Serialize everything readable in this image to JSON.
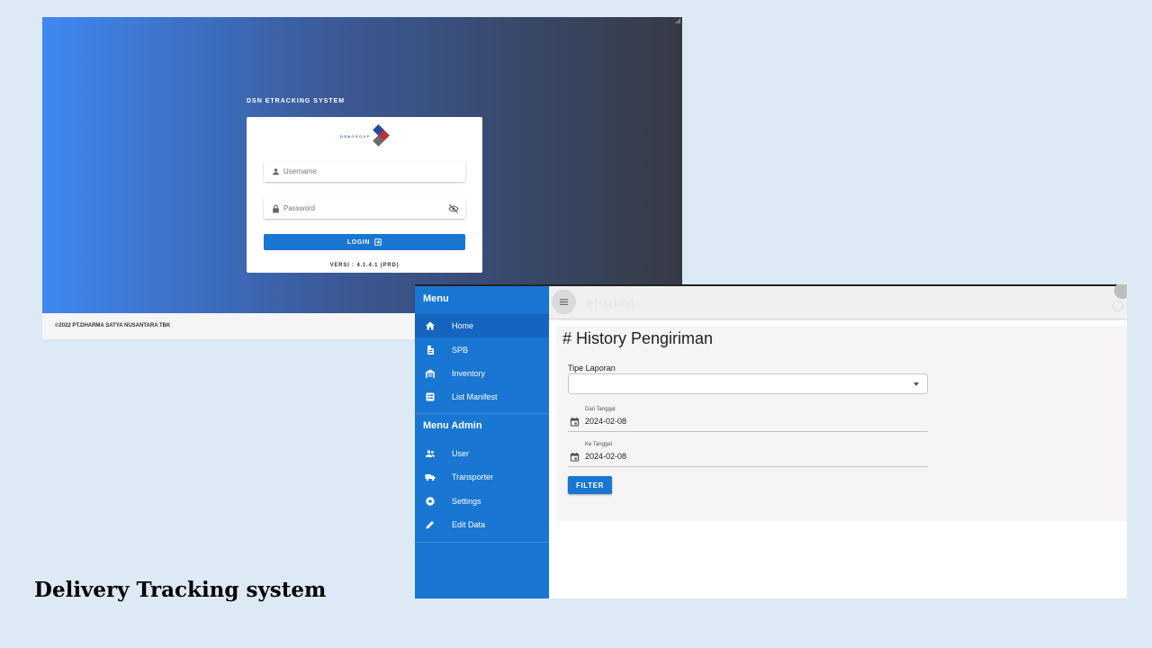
{
  "login": {
    "system_title": "DSN ETRACKING SYSTEM",
    "brand_text_prefix": "DSN",
    "brand_text_suffix": "GROUP",
    "username_placeholder": "Username",
    "password_placeholder": "Password",
    "login_label": "LOGIN",
    "version": "VERSI : 4.1.4.1 (PRD)",
    "footer": "©2022 PT.DHARMA SATYA NUSANTARA TBK",
    "colors": {
      "gradient_start": "#3f88f2",
      "gradient_end": "#363a44",
      "button": "#1976d2"
    }
  },
  "dashboard": {
    "app_title": "eTracking",
    "menu_header": "Menu",
    "menu_items": [
      {
        "label": "Home",
        "icon": "home-icon",
        "active": true
      },
      {
        "label": "SPB",
        "icon": "document-icon"
      },
      {
        "label": "Inventory",
        "icon": "warehouse-icon"
      },
      {
        "label": "List Manifest",
        "icon": "list-icon"
      }
    ],
    "admin_header": "Menu Admin",
    "admin_items": [
      {
        "label": "User",
        "icon": "users-icon"
      },
      {
        "label": "Transporter",
        "icon": "truck-icon"
      },
      {
        "label": "Settings",
        "icon": "gear-icon"
      },
      {
        "label": "Edit Data",
        "icon": "pencil-icon"
      }
    ],
    "page_title": "# History Pengiriman",
    "tipe_label": "Tipe Laporan",
    "tipe_value": "",
    "dari_label": "Dari Tanggal",
    "dari_value": "2024-02-08",
    "ke_label": "Ke Tanggal",
    "ke_value": "2024-02-08",
    "filter_label": "FILTER",
    "colors": {
      "sidebar": "#1976d2",
      "active_item": "#1565c0"
    }
  },
  "caption": "Delivery Tracking system"
}
